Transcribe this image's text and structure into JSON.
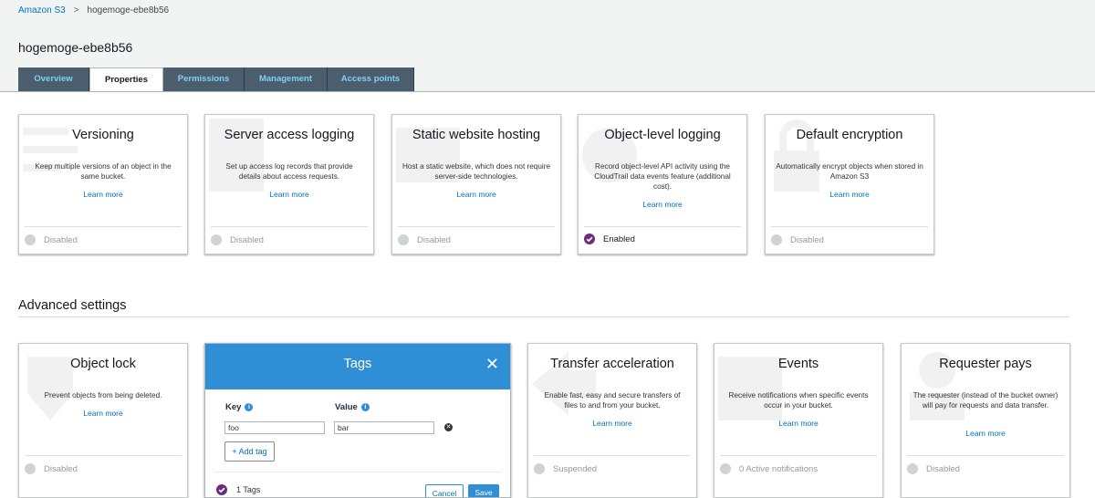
{
  "breadcrumb": {
    "root": "Amazon S3",
    "separator": ">",
    "current": "hogemoge-ebe8b56"
  },
  "page_title": "hogemoge-ebe8b56",
  "tabs": [
    "Overview",
    "Properties",
    "Permissions",
    "Management",
    "Access points"
  ],
  "active_tab": "Properties",
  "learn_more": "Learn more",
  "properties_cards": [
    {
      "title": "Versioning",
      "description": "Keep multiple versions of an object in the same bucket.",
      "status": "Disabled"
    },
    {
      "title": "Server access logging",
      "description": "Set up access log records that provide details about access requests.",
      "status": "Disabled"
    },
    {
      "title": "Static website hosting",
      "description": "Host a static website, which does not require server-side technologies.",
      "status": "Disabled"
    },
    {
      "title": "Object-level logging",
      "description": "Record object-level API activity using the CloudTrail data events feature (additional cost).",
      "status": "Enabled"
    },
    {
      "title": "Default encryption",
      "description": "Automatically encrypt objects when stored in Amazon S3",
      "status": "Disabled"
    }
  ],
  "advanced_title": "Advanced settings",
  "advanced_cards": [
    {
      "title": "Object lock",
      "description": "Prevent objects from being deleted.",
      "status": "Disabled"
    },
    {
      "title": "Transfer acceleration",
      "description": "Enable fast, easy and secure transfers of files to and from your bucket.",
      "status": "Suspended"
    },
    {
      "title": "Events",
      "description": "Receive notifications when specific events occur in your bucket.",
      "status": "0 Active notifications"
    },
    {
      "title": "Requester pays",
      "description": "The requester (instead of the bucket owner) will pay for requests and data transfer.",
      "status": "Disabled"
    }
  ],
  "tags_panel": {
    "title": "Tags",
    "close": "✕",
    "key_label": "Key",
    "value_label": "Value",
    "info": "i",
    "rows": [
      {
        "key": "foo",
        "value": "bar"
      }
    ],
    "remove": "✕",
    "add_tag": "+ Add tag",
    "count": "1 Tags",
    "cancel": "Cancel",
    "save": "Save"
  },
  "colors": {
    "accent": "#2e8ed6",
    "tab_bg": "#4c5d6d",
    "enabled": "#6b2d7f",
    "link": "#0073bb"
  }
}
